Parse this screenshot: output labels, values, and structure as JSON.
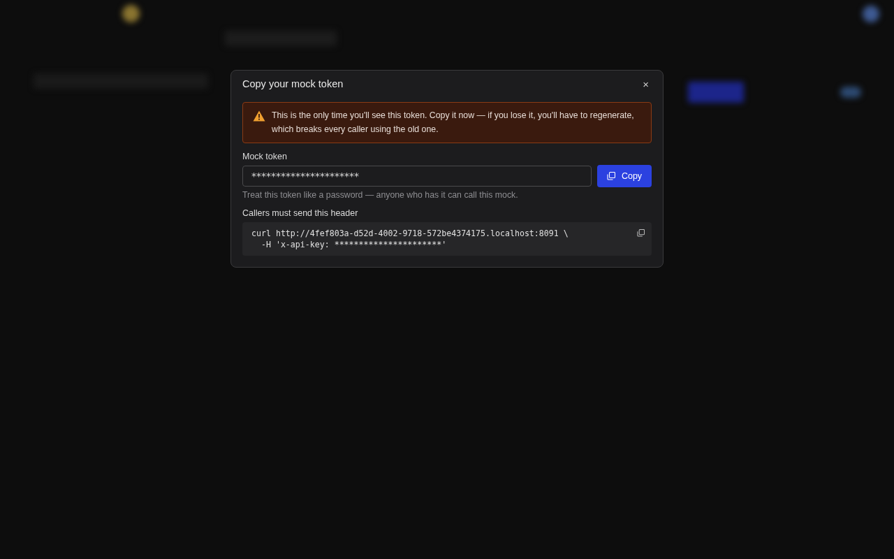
{
  "dialog": {
    "title": "Copy your mock token",
    "close_label": "×",
    "warning": "This is the only time you'll see this token. Copy it now — if you lose it, you'll have to regenerate, which breaks every caller using the old one.",
    "token_field": {
      "label": "Mock token",
      "value": "**********************",
      "hint": "Treat this token like a password — anyone who has it can call this mock."
    },
    "copy_button": "Copy",
    "header_section": {
      "label": "Callers must send this header",
      "code_lines": [
        "curl http://4fef803a-d52d-4002-9718-572be4374175.localhost:8091 \\",
        "  -H 'x-api-key: **********************'"
      ]
    }
  }
}
